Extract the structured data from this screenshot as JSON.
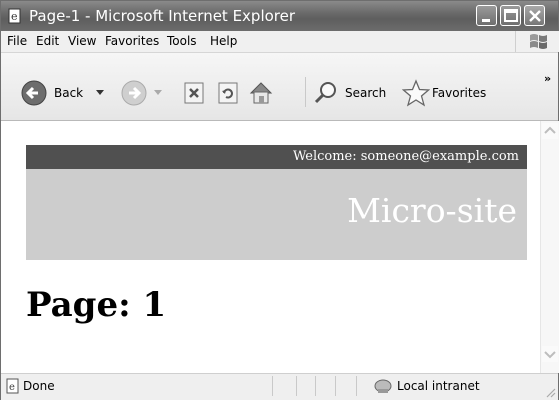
{
  "window": {
    "title": "Page-1 - Microsoft Internet Explorer"
  },
  "menu": {
    "items": [
      {
        "label": "File"
      },
      {
        "label": "Edit"
      },
      {
        "label": "View"
      },
      {
        "label": "Favorites"
      },
      {
        "label": "Tools"
      },
      {
        "label": "Help"
      }
    ]
  },
  "toolbar": {
    "back_label": "Back",
    "search_label": "Search",
    "favorites_label": "Favorites",
    "more_label": "»"
  },
  "page": {
    "welcome_text": "Welcome: someone@example.com",
    "site_title": "Micro-site",
    "heading": "Page: 1"
  },
  "status": {
    "text": "Done",
    "zone": "Local intranet"
  },
  "colors": {
    "header_dark": "#505050",
    "header_gray": "#cdcdcd"
  }
}
